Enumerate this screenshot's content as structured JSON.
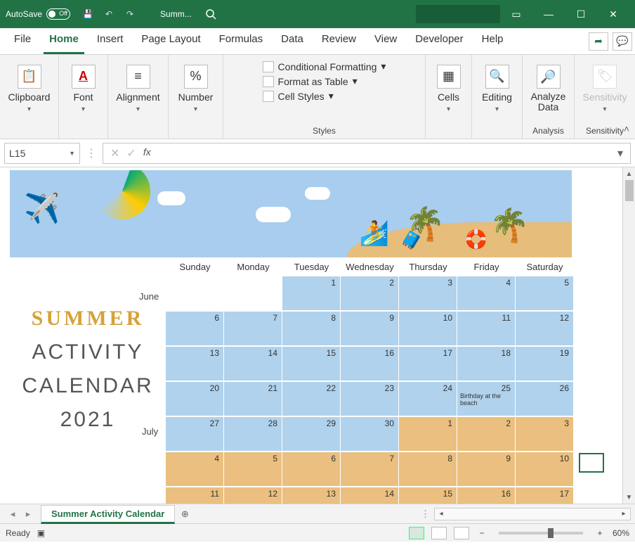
{
  "titlebar": {
    "autosave_label": "AutoSave",
    "autosave_state": "Off",
    "doc_name": "Summ...",
    "buttons": {
      "save": "💾",
      "undo": "↶",
      "redo": "↷"
    }
  },
  "tabs": {
    "items": [
      "File",
      "Home",
      "Insert",
      "Page Layout",
      "Formulas",
      "Data",
      "Review",
      "View",
      "Developer",
      "Help"
    ],
    "active": "Home"
  },
  "ribbon": {
    "groups": {
      "clipboard": "Clipboard",
      "font": "Font",
      "alignment": "Alignment",
      "number": "Number",
      "styles": "Styles",
      "cells": "Cells",
      "editing": "Editing",
      "analysis": "Analysis",
      "sensitivity": "Sensitivity"
    },
    "styles_items": [
      "Conditional Formatting",
      "Format as Table",
      "Cell Styles"
    ],
    "analyze_label": "Analyze Data",
    "sensitivity_label": "Sensitivity"
  },
  "formula_bar": {
    "name_box": "L15",
    "fx": "fx",
    "value": ""
  },
  "sheet": {
    "title_lines": [
      "SUMMER",
      "ACTIVITY",
      "CALENDAR",
      "2021"
    ],
    "month_labels": [
      "June",
      "July"
    ],
    "day_headers": [
      "Sunday",
      "Monday",
      "Tuesday",
      "Wednesday",
      "Thursday",
      "Friday",
      "Saturday"
    ],
    "weeks": [
      [
        {
          "blank": true
        },
        {
          "blank": true
        },
        {
          "n": 1,
          "m": "june"
        },
        {
          "n": 2,
          "m": "june"
        },
        {
          "n": 3,
          "m": "june"
        },
        {
          "n": 4,
          "m": "june"
        },
        {
          "n": 5,
          "m": "june"
        }
      ],
      [
        {
          "n": 6,
          "m": "june"
        },
        {
          "n": 7,
          "m": "june"
        },
        {
          "n": 8,
          "m": "june"
        },
        {
          "n": 9,
          "m": "june"
        },
        {
          "n": 10,
          "m": "june"
        },
        {
          "n": 11,
          "m": "june"
        },
        {
          "n": 12,
          "m": "june"
        }
      ],
      [
        {
          "n": 13,
          "m": "june"
        },
        {
          "n": 14,
          "m": "june"
        },
        {
          "n": 15,
          "m": "june"
        },
        {
          "n": 16,
          "m": "june"
        },
        {
          "n": 17,
          "m": "june"
        },
        {
          "n": 18,
          "m": "june"
        },
        {
          "n": 19,
          "m": "june"
        }
      ],
      [
        {
          "n": 20,
          "m": "june"
        },
        {
          "n": 21,
          "m": "june"
        },
        {
          "n": 22,
          "m": "june"
        },
        {
          "n": 23,
          "m": "june"
        },
        {
          "n": 24,
          "m": "june"
        },
        {
          "n": 25,
          "m": "june",
          "note": "Birthday at the beach"
        },
        {
          "n": 26,
          "m": "june"
        }
      ],
      [
        {
          "n": 27,
          "m": "june"
        },
        {
          "n": 28,
          "m": "june"
        },
        {
          "n": 29,
          "m": "june"
        },
        {
          "n": 30,
          "m": "june"
        },
        {
          "n": 1,
          "m": "july"
        },
        {
          "n": 2,
          "m": "july"
        },
        {
          "n": 3,
          "m": "july"
        }
      ],
      [
        {
          "n": 4,
          "m": "july"
        },
        {
          "n": 5,
          "m": "july"
        },
        {
          "n": 6,
          "m": "july"
        },
        {
          "n": 7,
          "m": "july"
        },
        {
          "n": 8,
          "m": "july"
        },
        {
          "n": 9,
          "m": "july"
        },
        {
          "n": 10,
          "m": "july"
        }
      ],
      [
        {
          "n": 11,
          "m": "july"
        },
        {
          "n": 12,
          "m": "july"
        },
        {
          "n": 13,
          "m": "july"
        },
        {
          "n": 14,
          "m": "july"
        },
        {
          "n": 15,
          "m": "july"
        },
        {
          "n": 16,
          "m": "july"
        },
        {
          "n": 17,
          "m": "july"
        }
      ]
    ]
  },
  "sheet_tabs": {
    "active": "Summer Activity Calendar"
  },
  "status": {
    "ready": "Ready",
    "zoom": "60%"
  }
}
